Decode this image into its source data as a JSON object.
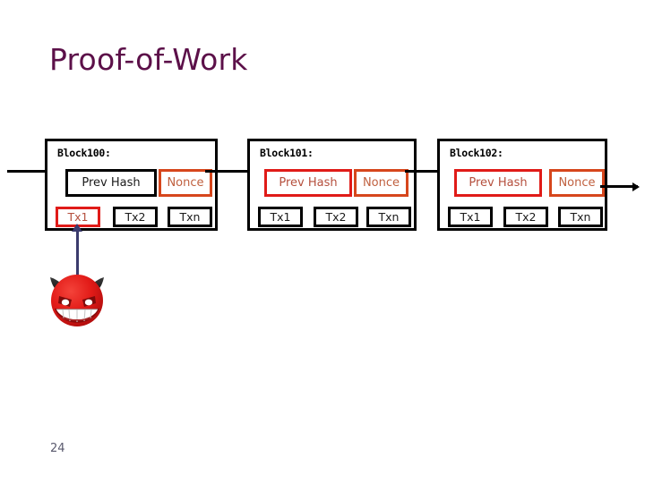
{
  "slide": {
    "title": "Proof-of-Work",
    "page_number": "24",
    "title_color": "#5C1049",
    "page_number_color": "#5A5A6E"
  },
  "colors": {
    "black": "#000000",
    "red": "#E01B18",
    "orange": "#D6461C",
    "red_text": "#B5503E",
    "orange_text": "#C0603F",
    "attacker_arrow": "#3B3B6D",
    "devil_body": "#E02020",
    "devil_horn": "#1C1C1C"
  },
  "chain": {
    "blocks": [
      {
        "label": "Block100:",
        "prev_hash": {
          "text": "Prev Hash",
          "style": "black"
        },
        "nonce": {
          "text": "Nonce",
          "style": "orange"
        },
        "transactions": [
          {
            "text": "Tx1",
            "style": "red"
          },
          {
            "text": "Tx2",
            "style": "black"
          },
          {
            "text": "Txn",
            "style": "black"
          }
        ]
      },
      {
        "label": "Block101:",
        "prev_hash": {
          "text": "Prev Hash",
          "style": "red"
        },
        "nonce": {
          "text": "Nonce",
          "style": "orange"
        },
        "transactions": [
          {
            "text": "Tx1",
            "style": "black"
          },
          {
            "text": "Tx2",
            "style": "black"
          },
          {
            "text": "Txn",
            "style": "black"
          }
        ]
      },
      {
        "label": "Block102:",
        "prev_hash": {
          "text": "Prev Hash",
          "style": "red"
        },
        "nonce": {
          "text": "Nonce",
          "style": "orange"
        },
        "transactions": [
          {
            "text": "Tx1",
            "style": "black"
          },
          {
            "text": "Tx2",
            "style": "black"
          },
          {
            "text": "Txn",
            "style": "black"
          }
        ]
      }
    ]
  },
  "attacker": {
    "icon": "devil-emoji",
    "target": "Tx1"
  }
}
